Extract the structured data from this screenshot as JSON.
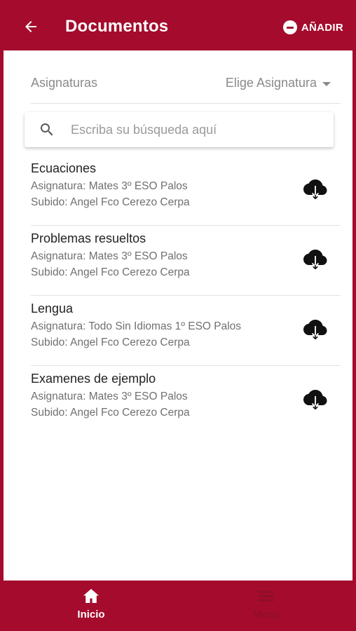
{
  "header": {
    "title": "Documentos",
    "add_label": "AÑADIR",
    "back_icon": "arrow-left-icon",
    "add_icon": "minus-circle-icon"
  },
  "filter": {
    "label": "Asignaturas",
    "selected": "Elige Asignatura"
  },
  "search": {
    "placeholder": "Escriba su búsqueda aquí",
    "value": ""
  },
  "documents": [
    {
      "name": "Ecuaciones",
      "subject": "Asignatura: Mates 3º ESO Palos",
      "uploader": "Subido: Angel Fco Cerezo Cerpa"
    },
    {
      "name": "Problemas resueltos",
      "subject": "Asignatura: Mates 3º ESO Palos",
      "uploader": "Subido: Angel Fco Cerezo Cerpa"
    },
    {
      "name": "Lengua",
      "subject": "Asignatura: Todo Sin Idiomas 1º ESO Palos",
      "uploader": "Subido: Angel Fco Cerezo Cerpa"
    },
    {
      "name": "Examenes de ejemplo",
      "subject": "Asignatura: Mates 3º ESO Palos",
      "uploader": "Subido: Angel Fco Cerezo Cerpa"
    }
  ],
  "bottom_nav": {
    "tabs": [
      {
        "label": "Inicio",
        "icon": "home-icon",
        "active": true
      },
      {
        "label": "Menu",
        "icon": "menu-icon",
        "active": false
      }
    ]
  },
  "colors": {
    "primary": "#a40b2c",
    "text_secondary": "#707070"
  }
}
